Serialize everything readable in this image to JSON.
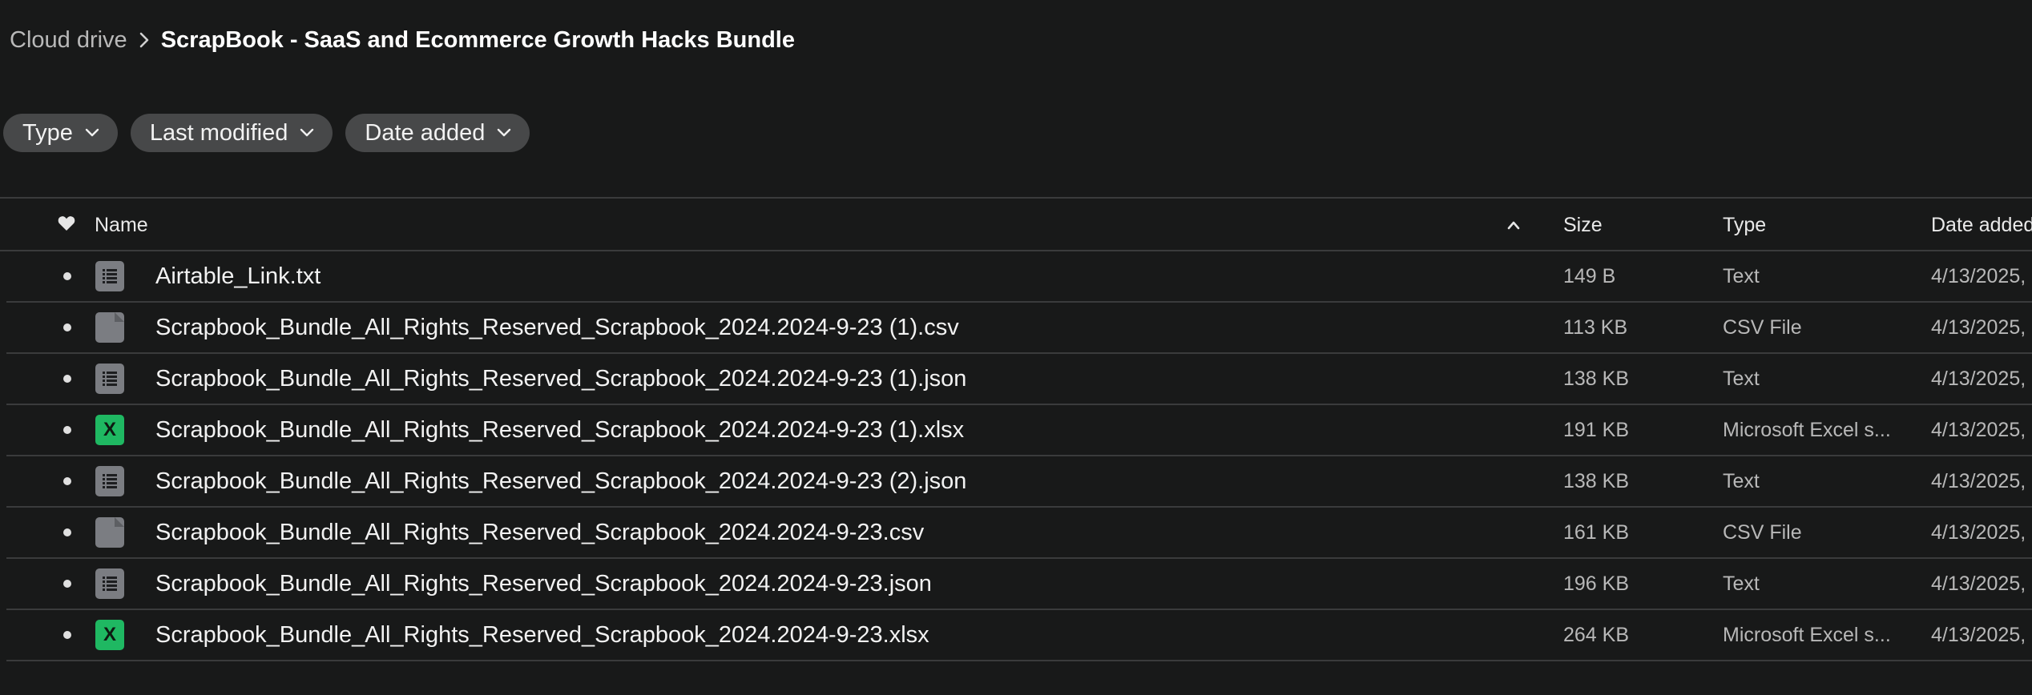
{
  "breadcrumb": {
    "root": "Cloud drive",
    "current": "ScrapBook - SaaS and Ecommerce Growth Hacks Bundle"
  },
  "filters": [
    {
      "label": "Type"
    },
    {
      "label": "Last modified"
    },
    {
      "label": "Date added"
    }
  ],
  "table": {
    "columns": {
      "name": "Name",
      "size": "Size",
      "type": "Type",
      "date_added": "Date added"
    },
    "sort": {
      "column": "name",
      "direction": "ascending"
    },
    "rows": [
      {
        "name": "Airtable_Link.txt",
        "size": "149 B",
        "type": "Text",
        "date_added": "4/13/2025,",
        "icon": "text-file-icon"
      },
      {
        "name": "Scrapbook_Bundle_All_Rights_Reserved_Scrapbook_2024.2024-9-23 (1).csv",
        "size": "113 KB",
        "type": "CSV File",
        "date_added": "4/13/2025,",
        "icon": "csv-file-icon"
      },
      {
        "name": "Scrapbook_Bundle_All_Rights_Reserved_Scrapbook_2024.2024-9-23 (1).json",
        "size": "138 KB",
        "type": "Text",
        "date_added": "4/13/2025,",
        "icon": "text-file-icon"
      },
      {
        "name": "Scrapbook_Bundle_All_Rights_Reserved_Scrapbook_2024.2024-9-23 (1).xlsx",
        "size": "191 KB",
        "type": "Microsoft Excel s...",
        "date_added": "4/13/2025,",
        "icon": "excel-file-icon"
      },
      {
        "name": "Scrapbook_Bundle_All_Rights_Reserved_Scrapbook_2024.2024-9-23 (2).json",
        "size": "138 KB",
        "type": "Text",
        "date_added": "4/13/2025,",
        "icon": "text-file-icon"
      },
      {
        "name": "Scrapbook_Bundle_All_Rights_Reserved_Scrapbook_2024.2024-9-23.csv",
        "size": "161 KB",
        "type": "CSV File",
        "date_added": "4/13/2025,",
        "icon": "csv-file-icon"
      },
      {
        "name": "Scrapbook_Bundle_All_Rights_Reserved_Scrapbook_2024.2024-9-23.json",
        "size": "196 KB",
        "type": "Text",
        "date_added": "4/13/2025,",
        "icon": "text-file-icon"
      },
      {
        "name": "Scrapbook_Bundle_All_Rights_Reserved_Scrapbook_2024.2024-9-23.xlsx",
        "size": "264 KB",
        "type": "Microsoft Excel s...",
        "date_added": "4/13/2025,",
        "icon": "excel-file-icon"
      }
    ]
  },
  "icons": {
    "excel_glyph": "X"
  },
  "colors": {
    "background": "#181919",
    "chip": "#474849",
    "divider": "#3a3b3c",
    "excel_green": "#1fb862",
    "generic_file_gray": "#7b7d82"
  }
}
